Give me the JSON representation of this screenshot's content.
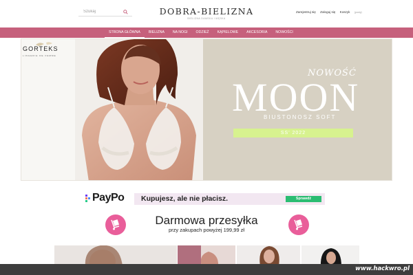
{
  "header": {
    "search_placeholder": "Szukaj",
    "logo_title": "DOBRA-BIELIZNA",
    "logo_tagline": "BIELIZNA DAMSKA I MĘSKA",
    "register": "Zarejestruj się",
    "login": "Zaloguj się",
    "cart": "Koszyk",
    "cart_count": "(pusty)"
  },
  "nav": {
    "items": [
      {
        "label": "Strona główna",
        "active": true
      },
      {
        "label": "Bielizna",
        "active": false
      },
      {
        "label": "Na nogi",
        "active": false
      },
      {
        "label": "Odzież",
        "active": false
      },
      {
        "label": "Kąpielowe",
        "active": false
      },
      {
        "label": "Akcesoria",
        "active": false
      },
      {
        "label": "Nowości",
        "active": false
      }
    ]
  },
  "hero": {
    "brand": "GORTEKS",
    "brand_sub": "LINGERIE DE FEMME",
    "nowosc": "NOWOŚĆ",
    "title": "MOON",
    "subtitle": "BIUSTONOSZ SOFT",
    "season": "SS' 2022"
  },
  "paypo": {
    "logo": "PayPo",
    "text": "Kupujesz, ale nie płacisz.",
    "button": "Sprawdź"
  },
  "shipping": {
    "title": "Darmowa przesyłka",
    "subtitle": "przy zakupach powyżej 199,99 zł"
  },
  "watermark": "www.hackwro.pl",
  "colors": {
    "nav_bg": "#c6607c",
    "hero_bg": "#d7d1c3",
    "season_bar": "#d7f28f",
    "paypo_bar": "#f2e7f1",
    "sprawdz_button": "#2bbd72",
    "ship_icon": "#e95e9a"
  }
}
